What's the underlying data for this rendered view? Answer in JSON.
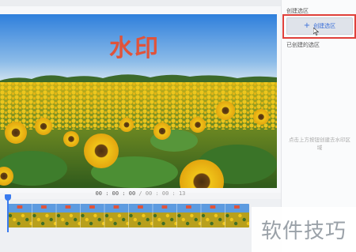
{
  "video": {
    "watermark_text": "水印",
    "scene_icon": "sunflower-field-image"
  },
  "time": {
    "current": "00 : 00 : 00",
    "separator": " / ",
    "total": "00 : 00 : 13"
  },
  "timeline": {
    "thumbnail_count": 10,
    "playhead_position": 0,
    "accent_color": "#3a7bef"
  },
  "right_panel": {
    "create_section_title": "创建选区",
    "create_button_label": "创建选区",
    "created_section_title": "已创建的选区",
    "empty_hint": "点击上方按钮创建去水印区域"
  },
  "site_watermark": "软件技巧",
  "colors": {
    "highlight": "#e0403a",
    "button_text": "#3a6fd8",
    "watermark_red": "#e0533a"
  }
}
